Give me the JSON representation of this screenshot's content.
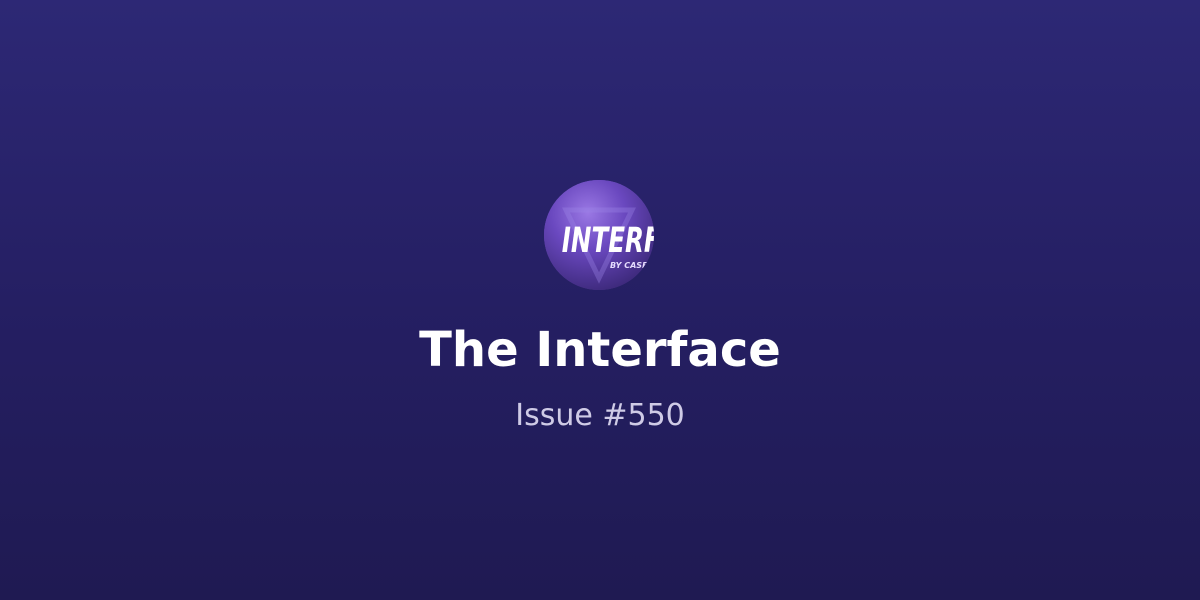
{
  "newsletter": {
    "logo_text": "INTERFACE",
    "logo_byline": "BY CASEY",
    "title": "The Interface",
    "issue": "Issue #550"
  },
  "colors": {
    "background_top": "#2d2875",
    "background_bottom": "#1f1a52",
    "title": "#ffffff",
    "subtitle": "#cfcbe6",
    "logo_accent": "#6d4bc2"
  }
}
